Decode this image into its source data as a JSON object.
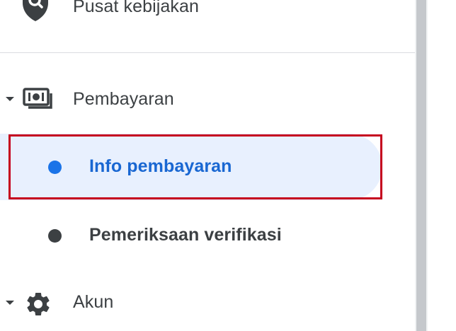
{
  "sidebar": {
    "policy_center": {
      "label": "Pusat kebijakan",
      "icon": "shield-search-icon"
    },
    "payments": {
      "label": "Pembayaran",
      "icon": "payments-cash-icon",
      "expanded": true,
      "children": [
        {
          "label": "Info pembayaran",
          "active": true
        },
        {
          "label": "Pemeriksaan verifikasi",
          "active": false
        }
      ]
    },
    "account": {
      "label": "Akun",
      "icon": "gear-icon",
      "expanded": true
    }
  },
  "colors": {
    "active_background": "#e8f0fe",
    "active_text": "#1967d2",
    "active_dot": "#1a73e8",
    "highlight_border": "#c5001e",
    "text": "#3c4043",
    "divider": "#dadce0"
  }
}
